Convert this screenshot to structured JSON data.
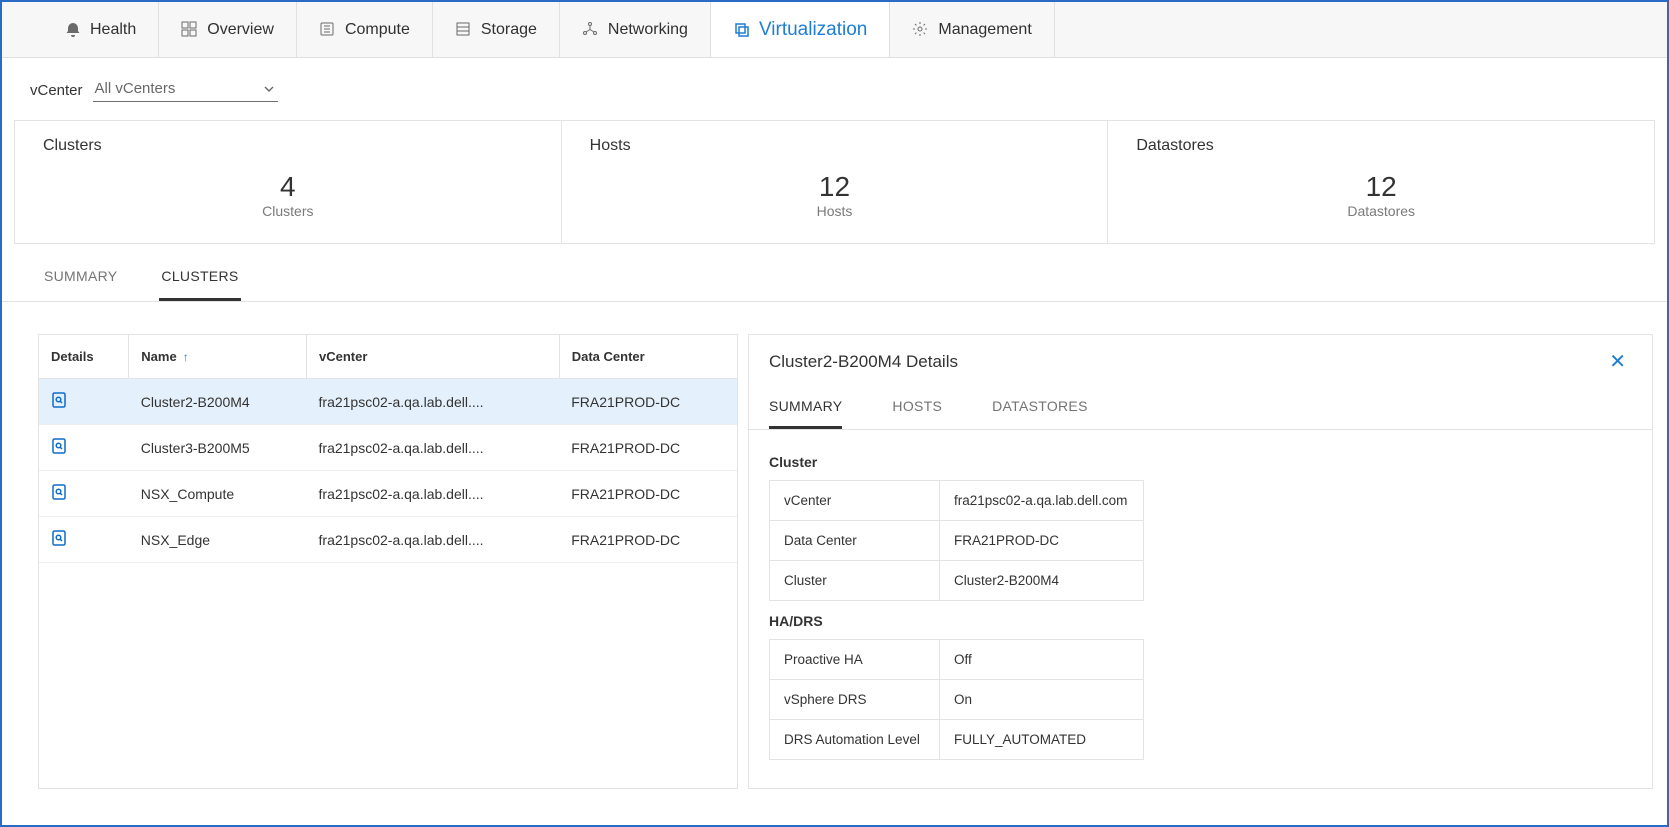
{
  "topnav": [
    {
      "id": "health",
      "label": "Health",
      "icon": "bell"
    },
    {
      "id": "overview",
      "label": "Overview",
      "icon": "grid"
    },
    {
      "id": "compute",
      "label": "Compute",
      "icon": "server"
    },
    {
      "id": "storage",
      "label": "Storage",
      "icon": "storage"
    },
    {
      "id": "networking",
      "label": "Networking",
      "icon": "network"
    },
    {
      "id": "virtualization",
      "label": "Virtualization",
      "icon": "copy",
      "active": true
    },
    {
      "id": "management",
      "label": "Management",
      "icon": "gear"
    }
  ],
  "filter": {
    "label": "vCenter",
    "selected": "All vCenters"
  },
  "stats": [
    {
      "title": "Clusters",
      "value": "4",
      "sub": "Clusters"
    },
    {
      "title": "Hosts",
      "value": "12",
      "sub": "Hosts"
    },
    {
      "title": "Datastores",
      "value": "12",
      "sub": "Datastores"
    }
  ],
  "subtabs": [
    {
      "id": "summary",
      "label": "SUMMARY"
    },
    {
      "id": "clusters",
      "label": "CLUSTERS",
      "active": true
    }
  ],
  "table": {
    "columns": [
      "Details",
      "Name",
      "vCenter",
      "Data Center"
    ],
    "sort_col": 1,
    "rows": [
      {
        "name": "Cluster2-B200M4",
        "vcenter": "fra21psc02-a.qa.lab.dell....",
        "dc": "FRA21PROD-DC",
        "selected": true
      },
      {
        "name": "Cluster3-B200M5",
        "vcenter": "fra21psc02-a.qa.lab.dell....",
        "dc": "FRA21PROD-DC"
      },
      {
        "name": "NSX_Compute",
        "vcenter": "fra21psc02-a.qa.lab.dell....",
        "dc": "FRA21PROD-DC"
      },
      {
        "name": "NSX_Edge",
        "vcenter": "fra21psc02-a.qa.lab.dell....",
        "dc": "FRA21PROD-DC"
      }
    ]
  },
  "details": {
    "title": "Cluster2-B200M4 Details",
    "tabs": [
      {
        "id": "summary",
        "label": "SUMMARY",
        "active": true
      },
      {
        "id": "hosts",
        "label": "HOSTS"
      },
      {
        "id": "datastores",
        "label": "DATASTORES"
      }
    ],
    "sections": [
      {
        "title": "Cluster",
        "rows": [
          {
            "k": "vCenter",
            "v": "fra21psc02-a.qa.lab.dell.com"
          },
          {
            "k": "Data Center",
            "v": "FRA21PROD-DC"
          },
          {
            "k": "Cluster",
            "v": "Cluster2-B200M4"
          }
        ]
      },
      {
        "title": "HA/DRS",
        "rows": [
          {
            "k": "Proactive HA",
            "v": "Off"
          },
          {
            "k": "vSphere DRS",
            "v": "On"
          },
          {
            "k": "DRS Automation Level",
            "v": "FULLY_AUTOMATED"
          }
        ]
      }
    ]
  }
}
